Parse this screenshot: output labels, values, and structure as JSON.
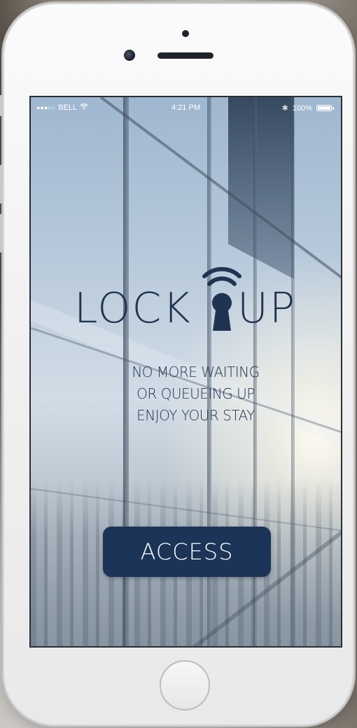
{
  "status_bar": {
    "signal": "●●●○○",
    "carrier": "BELL",
    "wifi_icon": "wifi-icon",
    "time": "4:21 PM",
    "bluetooth": "✱",
    "battery_text": "100%"
  },
  "logo": {
    "left_text": "LOCK",
    "right_text": "UP",
    "icon": "keyhole-wifi-icon",
    "color": "#1f3450"
  },
  "tagline": {
    "lines": [
      "NO MORE WAITING",
      "OR QUEUEING UP",
      "ENJOY YOUR STAY"
    ]
  },
  "access_button": {
    "label": "ACCESS",
    "color": "#1b3457"
  },
  "colors": {
    "brand_navy": "#1f3450",
    "button_navy": "#1b3457"
  }
}
